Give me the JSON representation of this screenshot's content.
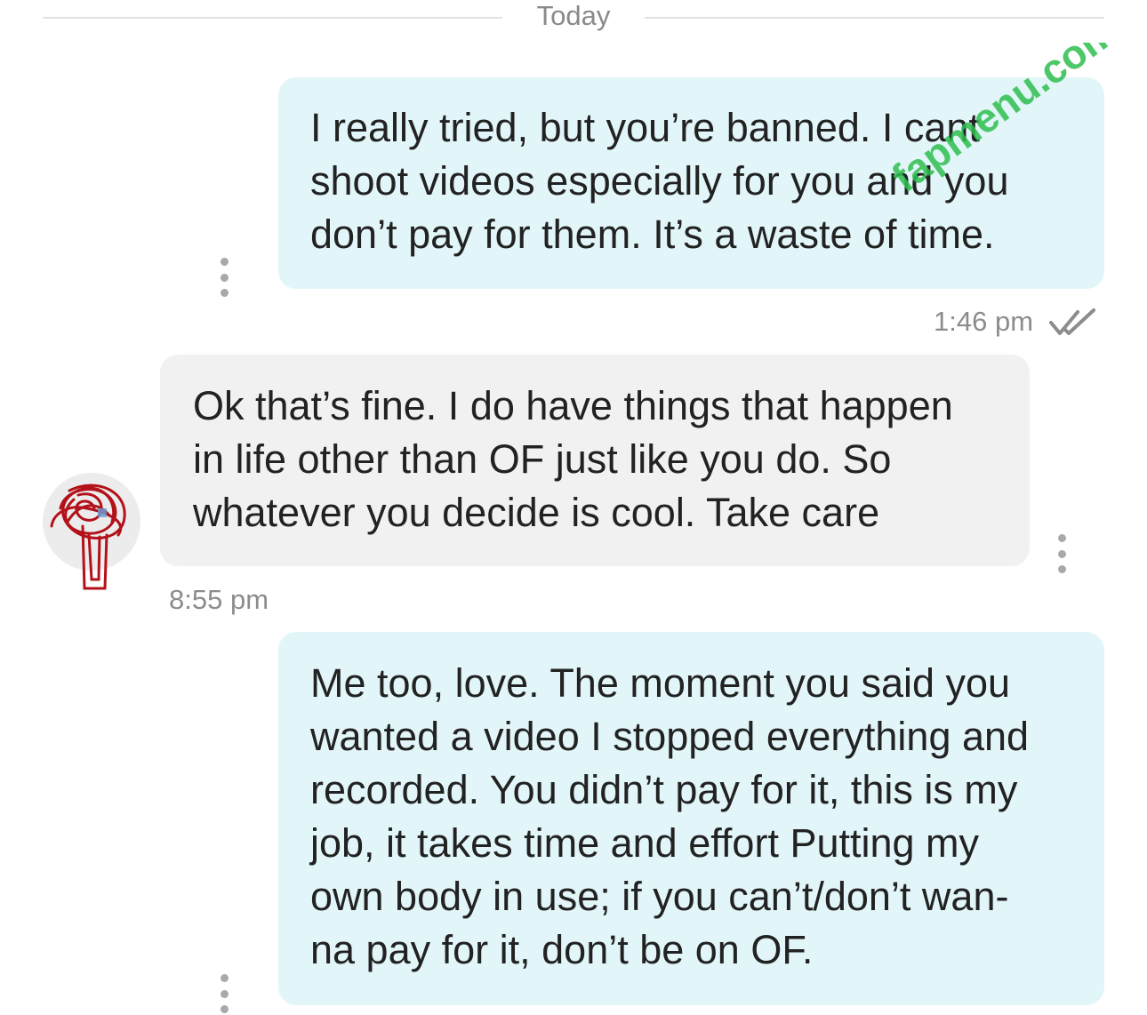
{
  "divider": {
    "label": "Today"
  },
  "messages": [
    {
      "direction": "outgoing",
      "lines": [
        "I really tried, but you’re banned. I cant",
        "shoot videos especially for you and you",
        "don’t pay for them. It’s a waste of time."
      ],
      "time": "1:46 pm",
      "status_icon": "double-check-icon"
    },
    {
      "direction": "incoming",
      "lines": [
        "Ok that’s fine. I do have things that happen",
        "in life other than OF just like you do. So",
        "whatever you decide is cool. Take care"
      ],
      "time": "8:55 pm",
      "avatar_icon": "avatar-scribble-icon"
    },
    {
      "direction": "outgoing",
      "lines": [
        "Me too, love. The moment you said you",
        "wanted a video I stopped everything and",
        "recorded. You didn’t pay for it, this is my",
        "job, it takes time and effort Putting my",
        "own body in use; if you can’t/don’t wan-",
        "na pay for it, don’t be on OF."
      ]
    }
  ],
  "more_menu_icon": "vertical-dots-icon",
  "watermark": {
    "text": "fapmenu.com",
    "color": "#2fbf4f"
  },
  "colors": {
    "outgoing_bubble": "#e2f6f9",
    "incoming_bubble": "#f1f1f1",
    "timestamp": "#8c8c8c",
    "avatar_scribble": "#b3121a"
  }
}
